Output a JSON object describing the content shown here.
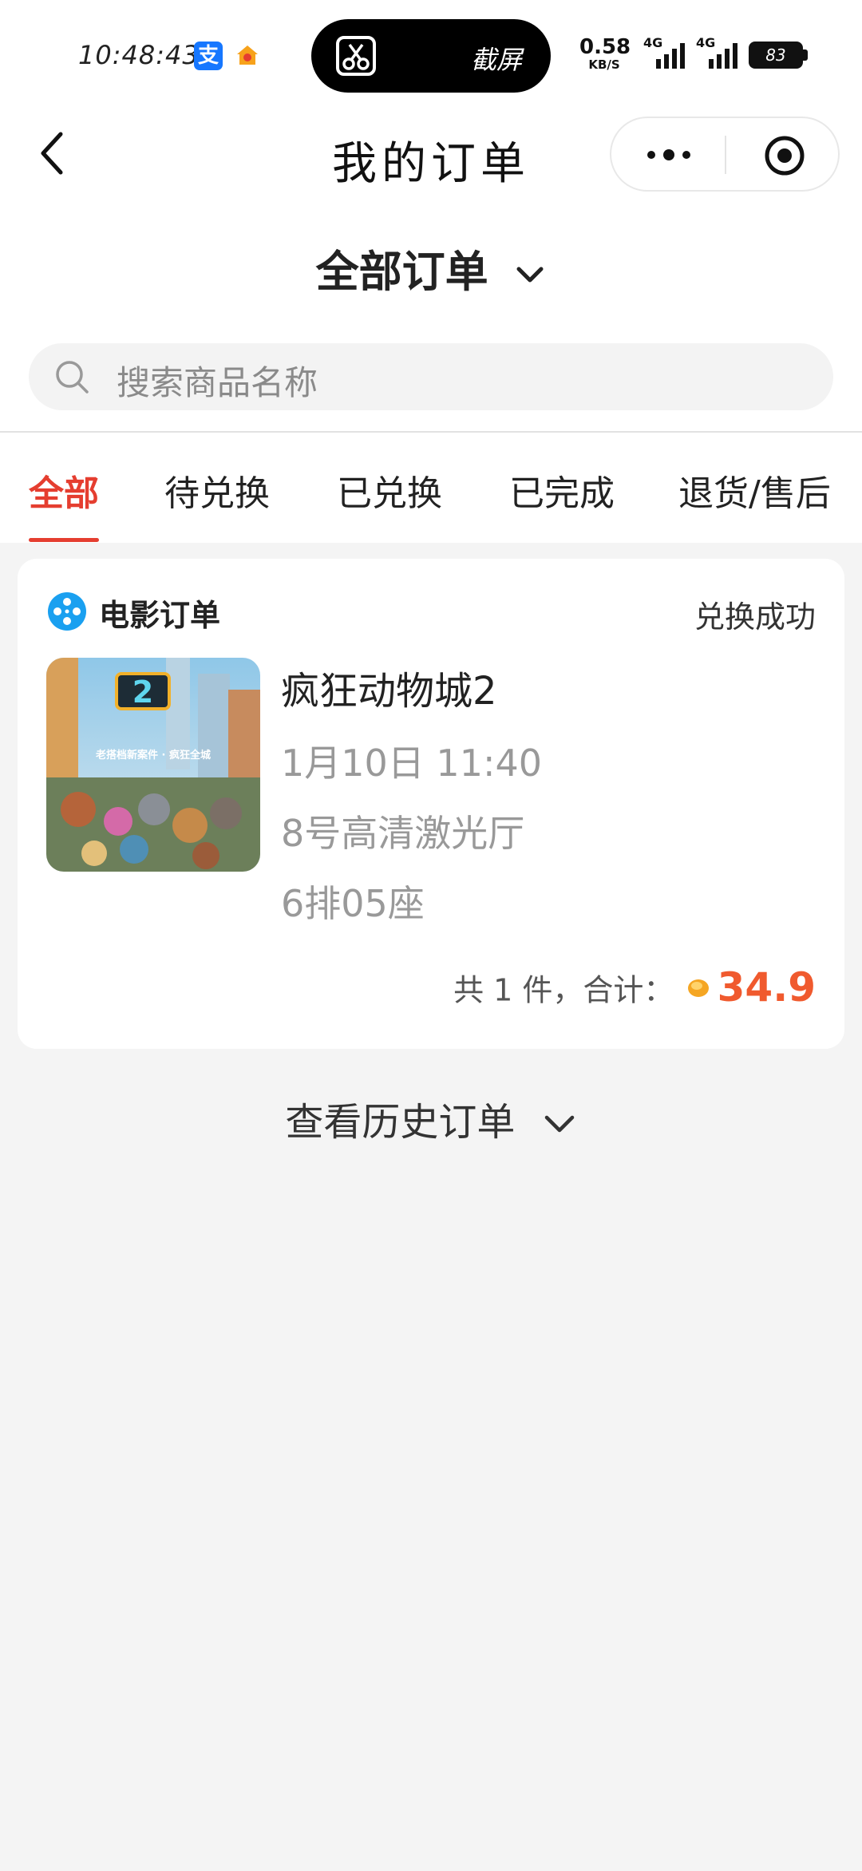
{
  "status_bar": {
    "time": "10:48:43",
    "capture_label": "截屏",
    "net_speed_value": "0.58",
    "net_speed_unit": "KB/S",
    "signal_1": "4G",
    "signal_2": "4G",
    "battery": "83"
  },
  "nav": {
    "title": "我的订单"
  },
  "order_filter": {
    "label": "全部订单"
  },
  "search": {
    "placeholder": "搜索商品名称"
  },
  "tabs": [
    {
      "label": "全部",
      "active": true
    },
    {
      "label": "待兑换",
      "active": false
    },
    {
      "label": "已兑换",
      "active": false
    },
    {
      "label": "已完成",
      "active": false
    },
    {
      "label": "退货/售后",
      "active": false
    }
  ],
  "order": {
    "category": "电影订单",
    "status": "兑换成功",
    "movie_title": "疯狂动物城2",
    "datetime": "1月10日 11:40",
    "hall": "8号高清激光厅",
    "seat": "6排05座",
    "summary_label": "共 1 件，合计：",
    "price": "34.9",
    "poster_text": "老搭档新案件 · 疯狂全城"
  },
  "history": {
    "label": "查看历史订单"
  },
  "colors": {
    "accent_red": "#e53e30",
    "price_orange": "#f05a2e",
    "movie_logo_blue": "#1aa0f0"
  }
}
